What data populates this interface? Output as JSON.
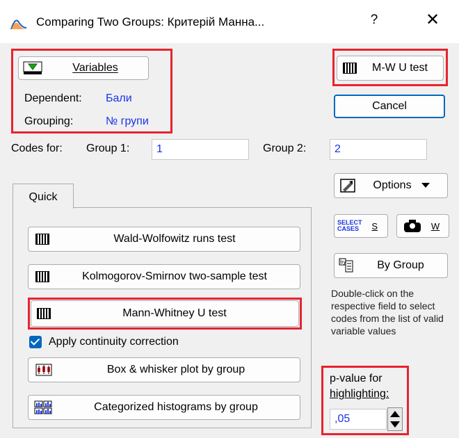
{
  "window": {
    "title": "Comparing Two Groups: Критерій Манна...",
    "help_glyph": "?",
    "close_glyph": "✕"
  },
  "variables": {
    "button_label": "Variables",
    "dependent_label": "Dependent:",
    "dependent_value": "Бали",
    "grouping_label": "Grouping:",
    "grouping_value": "№ групи"
  },
  "codes": {
    "codes_for_label": "Codes for:",
    "group1_label": "Group 1:",
    "group1_value": "1",
    "group2_label": "Group 2:",
    "group2_value": "2"
  },
  "right_buttons": {
    "mw_test": "M-W U test",
    "cancel": "Cancel",
    "options": "Options",
    "select_cases_line1": "SELECT",
    "select_cases_line2": "CASES",
    "select_cases_key": "S",
    "weight_key": "W",
    "by_group": "By Group"
  },
  "tabs": {
    "quick": "Quick"
  },
  "quick": {
    "wald_wolfowitz": "Wald-Wolfowitz runs test",
    "kolmogorov": "Kolmogorov-Smirnov two-sample test",
    "mann_whitney": "Mann-Whitney U test",
    "continuity_correction": "Apply continuity correction",
    "continuity_checked": true,
    "box_whisker": "Box & whisker plot by group",
    "histograms": "Categorized histograms by group"
  },
  "help_text": "Double-click on the respective field to select codes from the list of valid variable values",
  "pvalue": {
    "label_line1": "p-value for",
    "label_line2": "highlighting:",
    "value": ",05"
  },
  "colors": {
    "highlight_border": "#e8232f",
    "value_text": "#1a33e6",
    "checkbox": "#0067c0"
  }
}
